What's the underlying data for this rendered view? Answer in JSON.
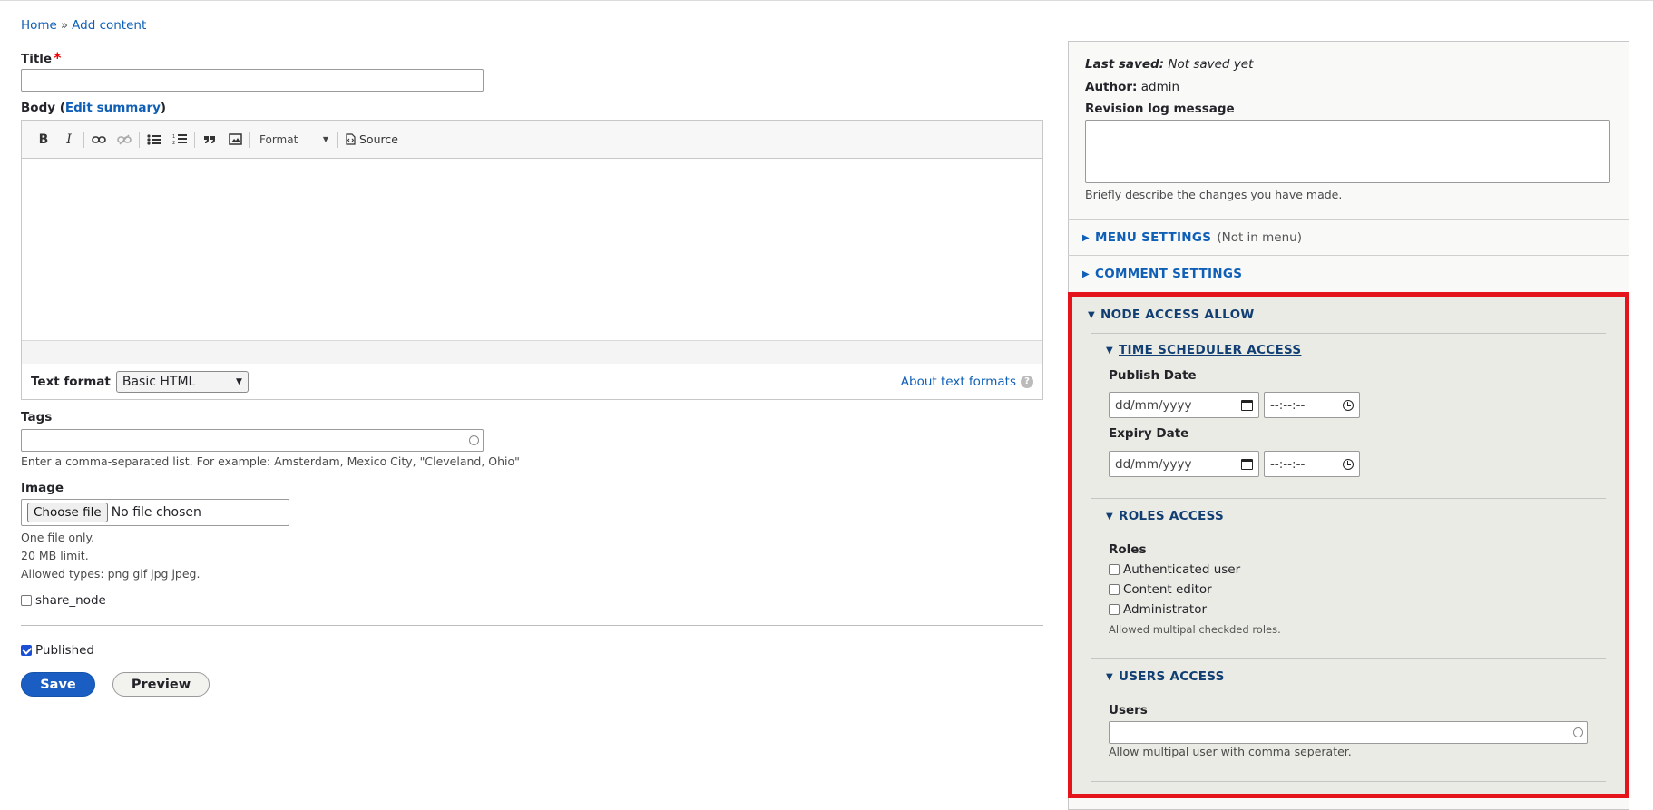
{
  "breadcrumb": {
    "home": "Home",
    "separator": "»",
    "current": "Add content"
  },
  "title_field": {
    "label": "Title",
    "required_mark": "*",
    "value": ""
  },
  "body_field": {
    "label_prefix": "Body (",
    "edit_summary": "Edit summary",
    "label_suffix": ")",
    "toolbar": {
      "bold": "B",
      "italic": "I",
      "format_label": "Format",
      "source_label": "Source"
    },
    "text_format_label": "Text format",
    "text_format_value": "Basic HTML",
    "about_link": "About text formats",
    "help_glyph": "?"
  },
  "tags_field": {
    "label": "Tags",
    "value": "",
    "description": "Enter a comma-separated list. For example: Amsterdam, Mexico City, \"Cleveland, Ohio\""
  },
  "image_field": {
    "label": "Image",
    "button": "Choose file",
    "status": "No file chosen",
    "desc_1": "One file only.",
    "desc_2": "20 MB limit.",
    "desc_3": "Allowed types: png gif jpg jpeg."
  },
  "share_node": {
    "label": "share_node",
    "checked": false
  },
  "published": {
    "label": "Published",
    "checked": true
  },
  "actions": {
    "save": "Save",
    "preview": "Preview"
  },
  "sidebar": {
    "last_saved_label": "Last saved:",
    "last_saved_value": "Not saved yet",
    "author_label": "Author:",
    "author_value": "admin",
    "revision_label": "Revision log message",
    "revision_value": "",
    "revision_desc": "Briefly describe the changes you have made.",
    "menu_settings": {
      "title": "MENU SETTINGS",
      "note": "(Not in menu)"
    },
    "comment_settings": {
      "title": "COMMENT SETTINGS"
    },
    "node_access": {
      "title": "NODE ACCESS ALLOW",
      "time_scheduler": {
        "title": "TIME SCHEDULER ACCESS",
        "publish_label": "Publish Date",
        "expiry_label": "Expiry Date",
        "date_placeholder": "dd/mm/yyyy",
        "time_placeholder": "--:--:--"
      },
      "roles_access": {
        "title": "ROLES ACCESS",
        "roles_label": "Roles",
        "roles": [
          "Authenticated user",
          "Content editor",
          "Administrator"
        ],
        "description": "Allowed multipal checkded roles."
      },
      "users_access": {
        "title": "USERS ACCESS",
        "users_label": "Users",
        "value": "",
        "description": "Allow multipal user with comma seperater."
      }
    }
  },
  "colors": {
    "link": "#0f5fb7",
    "highlight_border": "#e5141b",
    "save_button": "#1b5ec3"
  }
}
